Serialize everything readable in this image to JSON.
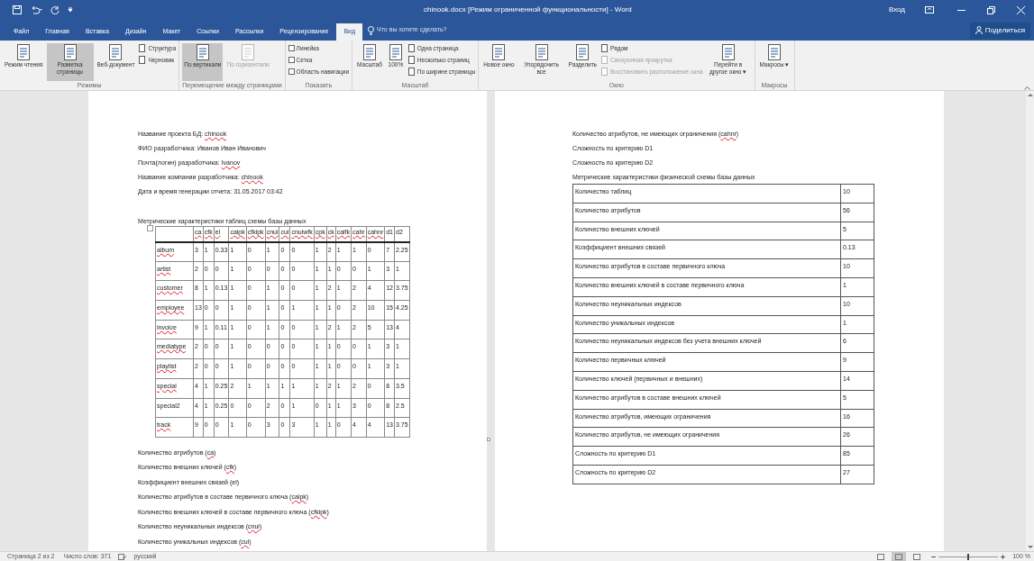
{
  "window": {
    "title": "chinook.docx [Режим ограниченной функциональности]  -  Word",
    "sign_in": "Вход"
  },
  "tabs": [
    {
      "label": "Файл",
      "selected": false
    },
    {
      "label": "Главная",
      "selected": false
    },
    {
      "label": "Вставка",
      "selected": false
    },
    {
      "label": "Дизайн",
      "selected": false
    },
    {
      "label": "Макет",
      "selected": false
    },
    {
      "label": "Ссылки",
      "selected": false
    },
    {
      "label": "Рассылки",
      "selected": false
    },
    {
      "label": "Рецензирование",
      "selected": false
    },
    {
      "label": "Вид",
      "selected": true
    }
  ],
  "tell_me": {
    "placeholder": "Что вы хотите сделать?"
  },
  "share_button": "Поделиться",
  "ribbon": [
    {
      "label": "Режимы",
      "items": [
        {
          "kind": "large",
          "label": "Режим чтения",
          "selected": false,
          "disabled": false
        },
        {
          "kind": "large",
          "label": "Разметка страницы",
          "selected": true,
          "disabled": false
        },
        {
          "kind": "large",
          "label": "Веб-документ",
          "selected": false,
          "disabled": false
        },
        {
          "kind": "small",
          "label": "Структура",
          "disabled": false
        },
        {
          "kind": "small",
          "label": "Черновик",
          "disabled": false
        }
      ]
    },
    {
      "label": "Перемещение между страницами",
      "items": [
        {
          "kind": "large",
          "label": "По вертикали",
          "selected": true,
          "disabled": false
        },
        {
          "kind": "large",
          "label": "По горизонтали",
          "selected": false,
          "disabled": true
        }
      ]
    },
    {
      "label": "Показать",
      "items": [
        {
          "kind": "checkbox",
          "label": "Линейка",
          "checked": false
        },
        {
          "kind": "checkbox",
          "label": "Сетка",
          "checked": false
        },
        {
          "kind": "checkbox",
          "label": "Область навигации",
          "checked": false
        }
      ]
    },
    {
      "label": "Масштаб",
      "items": [
        {
          "kind": "large",
          "label": "Масштаб",
          "selected": false,
          "disabled": false
        },
        {
          "kind": "large",
          "label": "100%",
          "selected": false,
          "disabled": false
        },
        {
          "kind": "small",
          "label": "Одна страница",
          "disabled": false
        },
        {
          "kind": "small",
          "label": "Несколько страниц",
          "disabled": false
        },
        {
          "kind": "small",
          "label": "По ширине страницы",
          "disabled": false
        }
      ]
    },
    {
      "label": "Окно",
      "items": [
        {
          "kind": "large",
          "label": "Новое окно",
          "selected": false,
          "disabled": false
        },
        {
          "kind": "large",
          "label": "Упорядочить все",
          "selected": false,
          "disabled": false
        },
        {
          "kind": "large",
          "label": "Разделить",
          "selected": false,
          "disabled": false
        },
        {
          "kind": "small",
          "label": "Рядом",
          "disabled": false
        },
        {
          "kind": "small",
          "label": "Синхронная прокрутка",
          "disabled": true
        },
        {
          "kind": "small",
          "label": "Восстановить расположение окна",
          "disabled": true
        },
        {
          "kind": "large",
          "label": "Перейти в другое окно ▾",
          "selected": false,
          "disabled": false
        }
      ]
    },
    {
      "label": "Макросы",
      "items": [
        {
          "kind": "large",
          "label": "Макросы ▾",
          "selected": false,
          "disabled": false
        }
      ]
    }
  ],
  "left_page": {
    "header_lines": [
      {
        "text": "Название проекта БД: ",
        "flagged_word": "chinook"
      },
      {
        "text": "ФИО разработчика: Иванов Иван Иванович"
      },
      {
        "text": "Почта(логин) разработчика: ",
        "flagged_word": "Ivanov"
      },
      {
        "text": "Название компании разработчика: ",
        "flagged_word": "chinook"
      },
      {
        "text": "Дата и время генерации отчета: 31.05.2017 03:42"
      }
    ],
    "table_title": "Метрические характеристики таблиц схемы базы данных",
    "table": {
      "columns": [
        {
          "text": "ca",
          "flagged": true
        },
        {
          "text": "cfk",
          "flagged": true
        },
        {
          "text": "el",
          "flagged": true
        },
        {
          "text": "caipk",
          "flagged": true
        },
        {
          "text": "cfkipk",
          "flagged": true
        },
        {
          "text": "cnui",
          "flagged": true
        },
        {
          "text": "cui",
          "flagged": true
        },
        {
          "text": "cnuiwfk",
          "flagged": true
        },
        {
          "text": "cpk",
          "flagged": true
        },
        {
          "text": "ck",
          "flagged": true
        },
        {
          "text": "caifk",
          "flagged": true
        },
        {
          "text": "cahr",
          "flagged": true
        },
        {
          "text": "cahnr",
          "flagged": true
        },
        {
          "text": "d1",
          "flagged": false
        },
        {
          "text": "d2",
          "flagged": false
        }
      ],
      "rows": [
        {
          "name": "album",
          "flagged": true,
          "values": [
            "3",
            "1",
            "0.33",
            "1",
            "0",
            "1",
            "0",
            "0",
            "1",
            "2",
            "1",
            "1",
            "0",
            "7",
            "2.25"
          ]
        },
        {
          "name": "artist",
          "flagged": true,
          "values": [
            "2",
            "0",
            "0",
            "1",
            "0",
            "0",
            "0",
            "0",
            "1",
            "1",
            "0",
            "0",
            "1",
            "3",
            "1"
          ]
        },
        {
          "name": "customer",
          "flagged": true,
          "values": [
            "8",
            "1",
            "0.13",
            "1",
            "0",
            "1",
            "0",
            "0",
            "1",
            "2",
            "1",
            "2",
            "4",
            "12",
            "3.75"
          ]
        },
        {
          "name": "employee",
          "flagged": true,
          "values": [
            "13",
            "0",
            "0",
            "1",
            "0",
            "1",
            "0",
            "1",
            "1",
            "1",
            "0",
            "2",
            "10",
            "15",
            "4.25"
          ]
        },
        {
          "name": "invoice",
          "flagged": true,
          "values": [
            "9",
            "1",
            "0.11",
            "1",
            "0",
            "1",
            "0",
            "0",
            "1",
            "2",
            "1",
            "2",
            "5",
            "13",
            "4"
          ]
        },
        {
          "name": "mediatype",
          "flagged": true,
          "values": [
            "2",
            "0",
            "0",
            "1",
            "0",
            "0",
            "0",
            "0",
            "1",
            "1",
            "0",
            "0",
            "1",
            "3",
            "1"
          ]
        },
        {
          "name": "playlist",
          "flagged": true,
          "values": [
            "2",
            "0",
            "0",
            "1",
            "0",
            "0",
            "0",
            "0",
            "1",
            "1",
            "0",
            "0",
            "1",
            "3",
            "1"
          ]
        },
        {
          "name": "special",
          "flagged": true,
          "values": [
            "4",
            "1",
            "0.25",
            "2",
            "1",
            "1",
            "1",
            "1",
            "1",
            "2",
            "1",
            "2",
            "0",
            "8",
            "3.5"
          ]
        },
        {
          "name": "special2",
          "flagged": false,
          "values": [
            "4",
            "1",
            "0.25",
            "0",
            "0",
            "2",
            "0",
            "1",
            "0",
            "1",
            "1",
            "3",
            "0",
            "8",
            "2.5"
          ]
        },
        {
          "name": "track",
          "flagged": true,
          "values": [
            "9",
            "0",
            "0",
            "1",
            "0",
            "3",
            "0",
            "3",
            "1",
            "1",
            "0",
            "4",
            "4",
            "13",
            "3.75"
          ]
        }
      ]
    },
    "legend_lines": [
      {
        "text": "Количество атрибутов (",
        "flagged_word": "ca",
        "after": ")"
      },
      {
        "text": "Количество внешних ключей (",
        "flagged_word": "cfk",
        "after": ")"
      },
      {
        "text": "Коэффициент внешних связей (el)"
      },
      {
        "text": "Количество атрибутов в составе первичного ключа (",
        "flagged_word": "caipk",
        "after": ")"
      },
      {
        "text": "Количество внешних ключей в составе первичного ключа (",
        "flagged_word": "cfkipk",
        "after": ")"
      },
      {
        "text": "Количество неуникальных индексов (",
        "flagged_word": "cnui",
        "after": ")"
      },
      {
        "text": "Количество уникальных индексов (",
        "flagged_word": "cui",
        "after": ")"
      }
    ]
  },
  "right_page": {
    "lines": [
      {
        "text": "Количество атрибутов, не имеющих ограничения (",
        "flagged_word": "cahnr",
        "after": ")"
      },
      {
        "text": "Сложность по критерию D1"
      },
      {
        "text": "Сложность по критерию D2"
      }
    ],
    "table_title": "Метрические характеристики физической схемы базы данных",
    "table": {
      "rows": [
        {
          "metric": "Количество таблиц",
          "value": "10"
        },
        {
          "metric": "Количество атрибутов",
          "value": "56"
        },
        {
          "metric": "Количество внешних ключей",
          "value": "5"
        },
        {
          "metric": "Коэффициент внешних связей",
          "value": "0.13"
        },
        {
          "metric": "Количество атрибутов в составе первичного ключа",
          "value": "10"
        },
        {
          "metric": "Количество внешних ключей в составе первичного ключа",
          "value": "1"
        },
        {
          "metric": "Количество неуникальных индексов",
          "value": "10"
        },
        {
          "metric": "Количество уникальных индексов",
          "value": "1"
        },
        {
          "metric": "Количество неуникальных индексов без учета внешних ключей",
          "value": "6"
        },
        {
          "metric": "Количество первичных ключей",
          "value": "9"
        },
        {
          "metric": "Количество ключей (первичных и внешних)",
          "value": "14"
        },
        {
          "metric": "Количество атрибутов в составе внешних ключей",
          "value": "5"
        },
        {
          "metric": "Количество атрибутов, имеющих ограничения",
          "value": "16"
        },
        {
          "metric": "Количество атрибутов, не имеющих ограничения",
          "value": "26"
        },
        {
          "metric": "Сложность по критерию D1",
          "value": "85"
        },
        {
          "metric": "Сложность по критерию D2",
          "value": "27"
        }
      ]
    }
  },
  "status_bar": {
    "page": "Страница 2 из 2",
    "words": "Число слов: 371",
    "language": "русский",
    "views": [
      {
        "selected": false
      },
      {
        "selected": true
      },
      {
        "selected": false
      }
    ],
    "zoom": {
      "level": 0.5,
      "reading": "100 %"
    }
  }
}
